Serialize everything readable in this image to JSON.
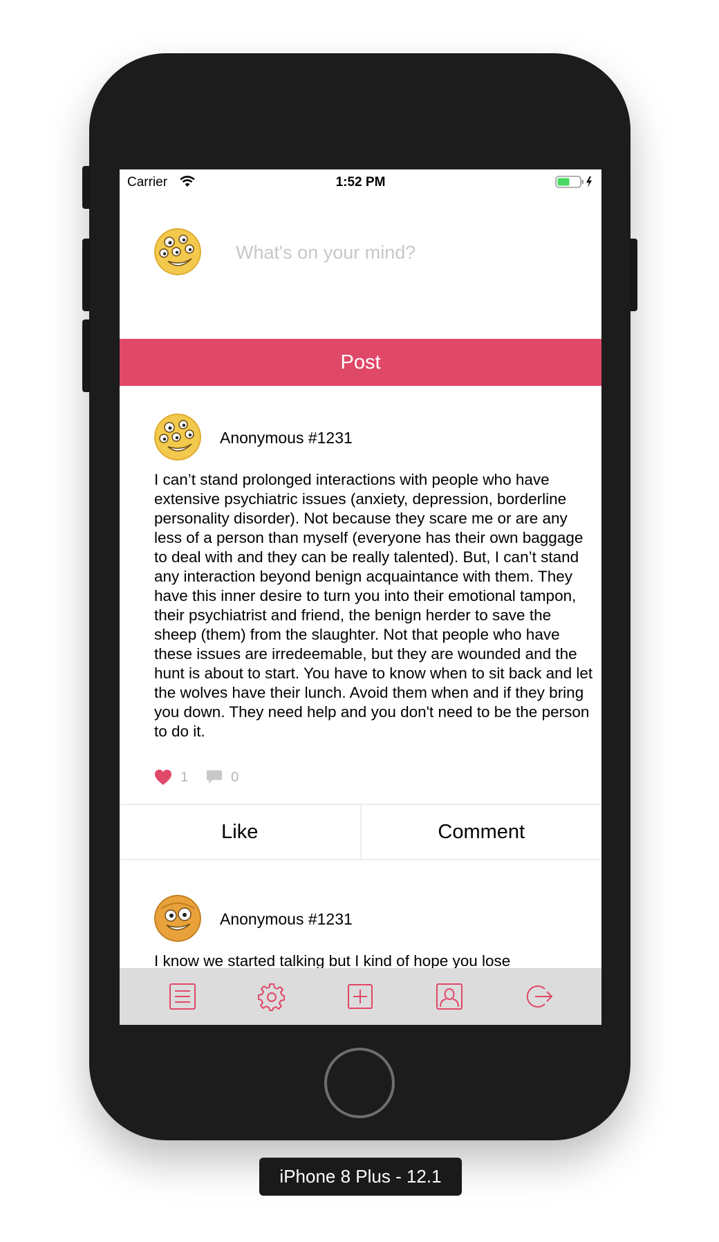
{
  "device": {
    "label": "iPhone 8 Plus - 12.1"
  },
  "status_bar": {
    "carrier": "Carrier",
    "time": "1:52 PM"
  },
  "composer": {
    "placeholder": "What's on your mind?",
    "post_label": "Post"
  },
  "posts": [
    {
      "author": "Anonymous #1231",
      "body": "I can’t stand prolonged interactions with people who have extensive psychiatric issues (anxiety, depression, borderline personality disorder). Not because they scare me or are any less of a person than myself (everyone has their own baggage to deal with and they can be really talented). But, I can’t stand any interaction beyond benign acquaintance with them. They have this inner desire to turn you into their emotional tampon, their psychiatrist and friend, the benign herder to save the sheep (them) from the slaughter. Not that people who have these issues are irredeemable, but they are wounded and the hunt is about to start. You have to know when to sit back and let the wolves have their lunch. Avoid them when and if they bring you down. They need help and you don't need to be the person to do it.",
      "likes": "1",
      "comments": "0",
      "like_label": "Like",
      "comment_label": "Comment"
    },
    {
      "author": "Anonymous #1231",
      "body": "I know we started talking but I kind of hope you lose"
    }
  ],
  "tab_bar": {
    "items": [
      {
        "name": "feed",
        "icon": "list-icon"
      },
      {
        "name": "settings",
        "icon": "gear-icon"
      },
      {
        "name": "new-post",
        "icon": "plus-square-icon"
      },
      {
        "name": "profile",
        "icon": "profile-icon"
      },
      {
        "name": "logout",
        "icon": "logout-icon"
      }
    ]
  },
  "colors": {
    "accent": "#e04868",
    "tab_bar_bg": "#dcdcdc",
    "device_body": "#1c1c1c",
    "muted_text": "#b5b5b5"
  }
}
